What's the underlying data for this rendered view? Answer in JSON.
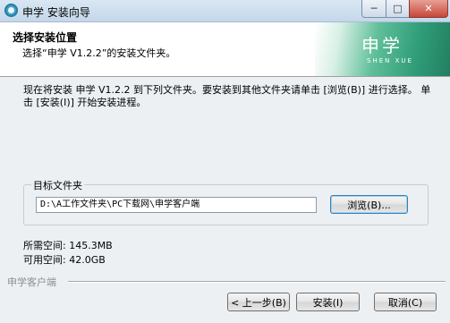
{
  "window": {
    "title": "申学 安装向导",
    "minimize": "─",
    "maximize": "□",
    "close": "✕"
  },
  "header": {
    "title": "选择安装位置",
    "subtitle": "选择“申学 V1.2.2”的安装文件夹。",
    "logo_text": "申学",
    "logo_sub": "SHEN XUE"
  },
  "body": {
    "description": "现在将安装 申学 V1.2.2 到下列文件夹。要安装到其他文件夹请单击 [浏览(B)] 进行选择。 单击 [安装(I)] 开始安装进程。",
    "target_group_label": "目标文件夹",
    "target_path": "D:\\A工作文件夹\\PC下载网\\申学客户端",
    "browse_label": "浏览(B)...",
    "space_required": "所需空间: 145.3MB",
    "space_available": "可用空间: 42.0GB"
  },
  "footer": {
    "brand": "申学客户端",
    "back_label": "< 上一步(B)",
    "install_label": "安装(I)",
    "cancel_label": "取消(C)"
  }
}
